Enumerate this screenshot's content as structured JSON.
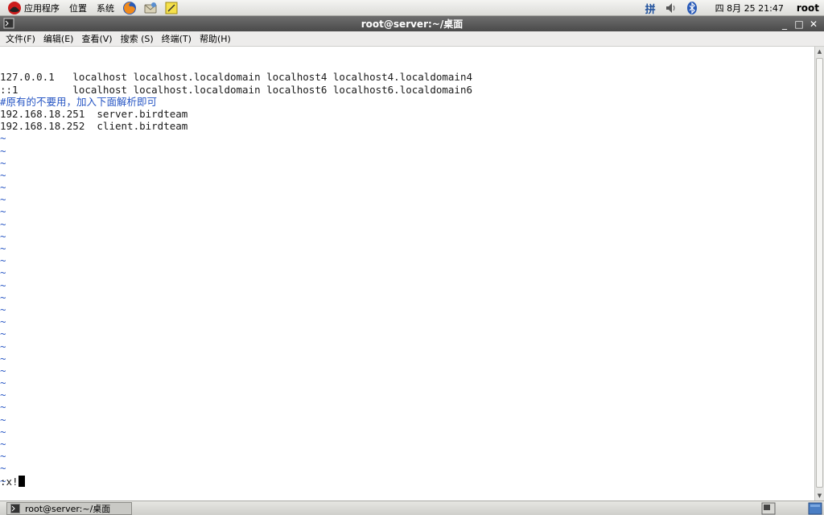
{
  "top_panel": {
    "menus": [
      "应用程序",
      "位置",
      "系统"
    ],
    "launchers": [
      "firefox-icon",
      "mail-icon",
      "notes-icon"
    ],
    "input_method": "拼",
    "clock": "四 8月 25 21:47",
    "user": "root"
  },
  "window": {
    "title": "root@server:~/桌面",
    "controls": [
      "_",
      "□",
      "✕"
    ]
  },
  "menubar": [
    "文件(F)",
    "编辑(E)",
    "查看(V)",
    "搜索 (S)",
    "终端(T)",
    "帮助(H)"
  ],
  "terminal": {
    "lines": [
      {
        "text": "127.0.0.1   localhost localhost.localdomain localhost4 localhost4.localdomain4",
        "type": "normal"
      },
      {
        "text": "::1         localhost localhost.localdomain localhost6 localhost6.localdomain6",
        "type": "normal"
      },
      {
        "text": "#原有的不要用，加入下面解析即可",
        "type": "comment"
      },
      {
        "text": "192.168.18.251  server.birdteam",
        "type": "normal"
      },
      {
        "text": "192.168.18.252  client.birdteam",
        "type": "normal"
      }
    ],
    "tilde": "~",
    "tilde_count": 29,
    "command": ":x!"
  },
  "taskbar": {
    "task_label": "root@server:~/桌面"
  },
  "colors": {
    "comment": "#2756c4",
    "titlebar": "#555555"
  }
}
